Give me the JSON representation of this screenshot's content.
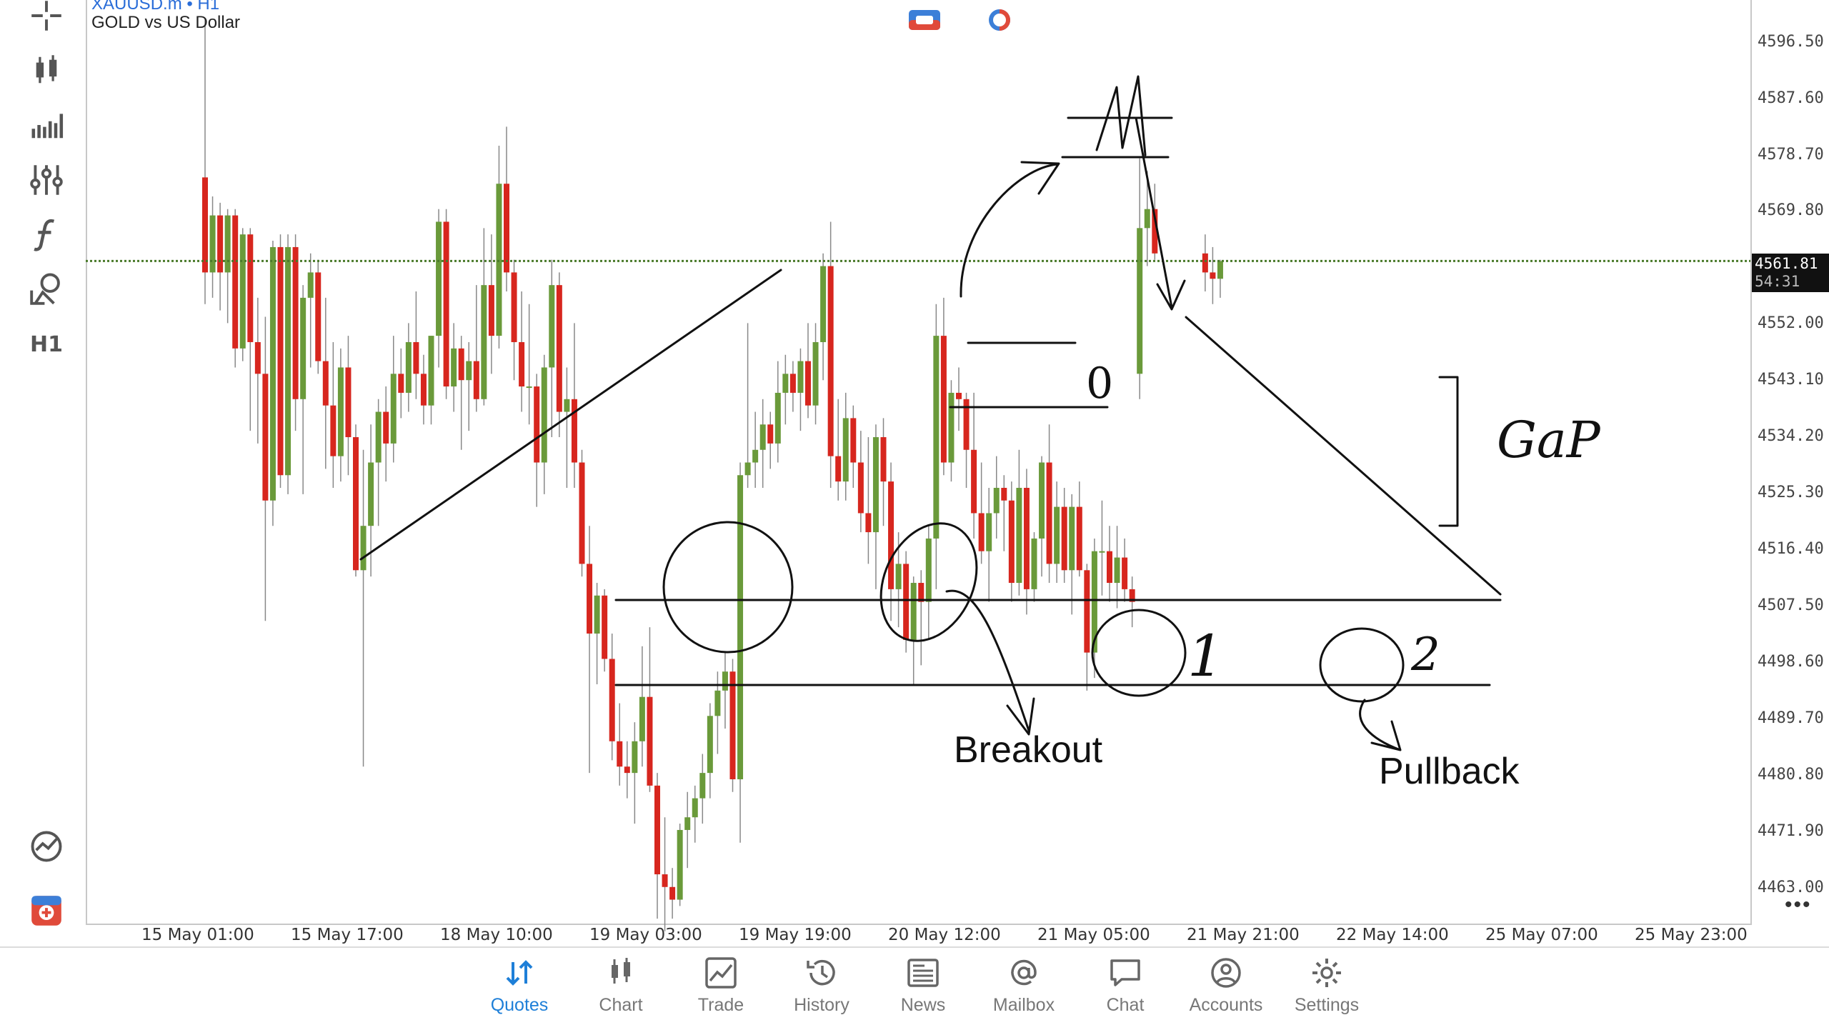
{
  "symbol": {
    "ticker": "XAUUSD.m • H1",
    "description": "GOLD vs US Dollar"
  },
  "toolbar": {
    "timeframe": "H1",
    "tools": [
      "crosshair-icon",
      "candles-icon",
      "indicators-icon",
      "settings-sliders-icon",
      "function-icon",
      "objects-icon"
    ]
  },
  "price_axis": [
    "4596.50",
    "4587.60",
    "4578.70",
    "4569.80",
    "4552.00",
    "4543.10",
    "4534.20",
    "4525.30",
    "4516.40",
    "4507.50",
    "4498.60",
    "4489.70",
    "4480.80",
    "4471.90",
    "4463.00"
  ],
  "current_price": {
    "price": "4561.81",
    "countdown": "54:31"
  },
  "time_axis": [
    "15 May 01:00",
    "15 May 17:00",
    "18 May 10:00",
    "19 May 03:00",
    "19 May 19:00",
    "20 May 12:00",
    "21 May 05:00",
    "21 May 21:00",
    "22 May 14:00",
    "25 May 07:00",
    "25 May 23:00"
  ],
  "annotations": {
    "gap": "GaP",
    "breakout": "Breakout",
    "pullback": "Pullback",
    "zero": "0",
    "one": "1",
    "two": "2"
  },
  "more": "•••",
  "nav": [
    {
      "label": "Quotes",
      "icon": "quotes-icon",
      "active": true
    },
    {
      "label": "Chart",
      "icon": "chart-icon",
      "active": false
    },
    {
      "label": "Trade",
      "icon": "trade-icon",
      "active": false
    },
    {
      "label": "History",
      "icon": "history-icon",
      "active": false
    },
    {
      "label": "News",
      "icon": "news-icon",
      "active": false
    },
    {
      "label": "Mailbox",
      "icon": "mailbox-icon",
      "active": false
    },
    {
      "label": "Chat",
      "icon": "chat-icon",
      "active": false
    },
    {
      "label": "Accounts",
      "icon": "accounts-icon",
      "active": false
    },
    {
      "label": "Settings",
      "icon": "settings-icon",
      "active": false
    }
  ],
  "colors": {
    "bull": "#6a9a3a",
    "bear": "#d7261e",
    "accent": "#1e7fd8",
    "bid_line": "#4a7a2a"
  },
  "chart_data": {
    "type": "candlestick",
    "timeframe": "H1",
    "candles": [
      {
        "o": 4575.0,
        "h": 4600.0,
        "l": 4555.0,
        "c": 4560.0
      },
      {
        "o": 4560.0,
        "h": 4572.0,
        "l": 4556.0,
        "c": 4569.0
      },
      {
        "o": 4569.0,
        "h": 4571.0,
        "l": 4554.0,
        "c": 4560.0
      },
      {
        "o": 4560.0,
        "h": 4570.0,
        "l": 4552.0,
        "c": 4569.0
      },
      {
        "o": 4569.0,
        "h": 4570.0,
        "l": 4545.0,
        "c": 4548.0
      },
      {
        "o": 4548.0,
        "h": 4567.0,
        "l": 4546.0,
        "c": 4566.0
      },
      {
        "o": 4566.0,
        "h": 4567.0,
        "l": 4535.0,
        "c": 4549.0
      },
      {
        "o": 4549.0,
        "h": 4556.0,
        "l": 4533.0,
        "c": 4544.0
      },
      {
        "o": 4544.0,
        "h": 4553.0,
        "l": 4505.0,
        "c": 4524.0
      },
      {
        "o": 4524.0,
        "h": 4565.0,
        "l": 4520.0,
        "c": 4564.0
      },
      {
        "o": 4564.0,
        "h": 4566.0,
        "l": 4526.0,
        "c": 4528.0
      },
      {
        "o": 4528.0,
        "h": 4566.0,
        "l": 4525.0,
        "c": 4564.0
      },
      {
        "o": 4564.0,
        "h": 4566.0,
        "l": 4535.0,
        "c": 4540.0
      },
      {
        "o": 4540.0,
        "h": 4558.0,
        "l": 4525.0,
        "c": 4556.0
      },
      {
        "o": 4556.0,
        "h": 4563.0,
        "l": 4545.0,
        "c": 4560.0
      },
      {
        "o": 4560.0,
        "h": 4562.0,
        "l": 4544.0,
        "c": 4546.0
      },
      {
        "o": 4546.0,
        "h": 4556.0,
        "l": 4529.0,
        "c": 4539.0
      },
      {
        "o": 4539.0,
        "h": 4549.0,
        "l": 4526.0,
        "c": 4531.0
      },
      {
        "o": 4531.0,
        "h": 4548.0,
        "l": 4527.0,
        "c": 4545.0
      },
      {
        "o": 4545.0,
        "h": 4550.0,
        "l": 4528.0,
        "c": 4534.0
      },
      {
        "o": 4534.0,
        "h": 4536.0,
        "l": 4512.0,
        "c": 4513.0
      },
      {
        "o": 4513.0,
        "h": 4532.0,
        "l": 4482.0,
        "c": 4520.0
      },
      {
        "o": 4520.0,
        "h": 4536.0,
        "l": 4512.0,
        "c": 4530.0
      },
      {
        "o": 4530.0,
        "h": 4540.0,
        "l": 4520.0,
        "c": 4538.0
      },
      {
        "o": 4538.0,
        "h": 4542.0,
        "l": 4527.0,
        "c": 4533.0
      },
      {
        "o": 4533.0,
        "h": 4550.0,
        "l": 4530.0,
        "c": 4544.0
      },
      {
        "o": 4544.0,
        "h": 4548.0,
        "l": 4537.0,
        "c": 4541.0
      },
      {
        "o": 4541.0,
        "h": 4552.0,
        "l": 4538.0,
        "c": 4549.0
      },
      {
        "o": 4549.0,
        "h": 4557.0,
        "l": 4540.0,
        "c": 4544.0
      },
      {
        "o": 4544.0,
        "h": 4547.0,
        "l": 4536.0,
        "c": 4539.0
      },
      {
        "o": 4539.0,
        "h": 4550.0,
        "l": 4536.0,
        "c": 4550.0
      },
      {
        "o": 4550.0,
        "h": 4570.0,
        "l": 4545.0,
        "c": 4568.0
      },
      {
        "o": 4568.0,
        "h": 4570.0,
        "l": 4540.0,
        "c": 4542.0
      },
      {
        "o": 4542.0,
        "h": 4552.0,
        "l": 4538.0,
        "c": 4548.0
      },
      {
        "o": 4548.0,
        "h": 4550.0,
        "l": 4532.0,
        "c": 4543.0
      },
      {
        "o": 4543.0,
        "h": 4549.0,
        "l": 4535.0,
        "c": 4546.0
      },
      {
        "o": 4546.0,
        "h": 4558.0,
        "l": 4538.0,
        "c": 4540.0
      },
      {
        "o": 4540.0,
        "h": 4567.0,
        "l": 4539.0,
        "c": 4558.0
      },
      {
        "o": 4558.0,
        "h": 4566.0,
        "l": 4544.0,
        "c": 4550.0
      },
      {
        "o": 4550.0,
        "h": 4580.0,
        "l": 4548.0,
        "c": 4574.0
      },
      {
        "o": 4574.0,
        "h": 4583.0,
        "l": 4557.0,
        "c": 4560.0
      },
      {
        "o": 4560.0,
        "h": 4562.0,
        "l": 4543.0,
        "c": 4549.0
      },
      {
        "o": 4549.0,
        "h": 4557.0,
        "l": 4538.0,
        "c": 4542.0
      },
      {
        "o": 4542.0,
        "h": 4555.0,
        "l": 4536.0,
        "c": 4542.0
      },
      {
        "o": 4542.0,
        "h": 4544.0,
        "l": 4523.0,
        "c": 4530.0
      },
      {
        "o": 4530.0,
        "h": 4547.0,
        "l": 4525.0,
        "c": 4545.0
      },
      {
        "o": 4545.0,
        "h": 4562.0,
        "l": 4534.0,
        "c": 4558.0
      },
      {
        "o": 4558.0,
        "h": 4560.0,
        "l": 4534.0,
        "c": 4538.0
      },
      {
        "o": 4538.0,
        "h": 4545.0,
        "l": 4526.0,
        "c": 4540.0
      },
      {
        "o": 4540.0,
        "h": 4552.0,
        "l": 4526.0,
        "c": 4530.0
      },
      {
        "o": 4530.0,
        "h": 4532.0,
        "l": 4512.0,
        "c": 4514.0
      },
      {
        "o": 4514.0,
        "h": 4520.0,
        "l": 4481.0,
        "c": 4503.0
      },
      {
        "o": 4503.0,
        "h": 4511.0,
        "l": 4495.0,
        "c": 4509.0
      },
      {
        "o": 4509.0,
        "h": 4510.0,
        "l": 4497.0,
        "c": 4499.0
      },
      {
        "o": 4499.0,
        "h": 4503.0,
        "l": 4483.0,
        "c": 4486.0
      },
      {
        "o": 4486.0,
        "h": 4492.0,
        "l": 4479.0,
        "c": 4482.0
      },
      {
        "o": 4482.0,
        "h": 4486.0,
        "l": 4477.0,
        "c": 4481.0
      },
      {
        "o": 4481.0,
        "h": 4489.0,
        "l": 4473.0,
        "c": 4486.0
      },
      {
        "o": 4486.0,
        "h": 4501.0,
        "l": 4482.0,
        "c": 4493.0
      },
      {
        "o": 4493.0,
        "h": 4504.0,
        "l": 4478.0,
        "c": 4479.0
      },
      {
        "o": 4479.0,
        "h": 4481.0,
        "l": 4458.0,
        "c": 4465.0
      },
      {
        "o": 4465.0,
        "h": 4474.0,
        "l": 4456.0,
        "c": 4463.0
      },
      {
        "o": 4463.0,
        "h": 4466.0,
        "l": 4458.0,
        "c": 4461.0
      },
      {
        "o": 4461.0,
        "h": 4473.0,
        "l": 4460.0,
        "c": 4472.0
      },
      {
        "o": 4472.0,
        "h": 4478.0,
        "l": 4466.0,
        "c": 4474.0
      },
      {
        "o": 4474.0,
        "h": 4479.0,
        "l": 4470.0,
        "c": 4477.0
      },
      {
        "o": 4477.0,
        "h": 4484.0,
        "l": 4473.0,
        "c": 4481.0
      },
      {
        "o": 4481.0,
        "h": 4492.0,
        "l": 4477.0,
        "c": 4490.0
      },
      {
        "o": 4490.0,
        "h": 4497.0,
        "l": 4484.0,
        "c": 4494.0
      },
      {
        "o": 4494.0,
        "h": 4500.0,
        "l": 4488.0,
        "c": 4497.0
      },
      {
        "o": 4497.0,
        "h": 4499.0,
        "l": 4478.0,
        "c": 4480.0
      },
      {
        "o": 4480.0,
        "h": 4530.0,
        "l": 4470.0,
        "c": 4528.0
      },
      {
        "o": 4528.0,
        "h": 4552.0,
        "l": 4526.0,
        "c": 4530.0
      },
      {
        "o": 4530.0,
        "h": 4538.0,
        "l": 4526.0,
        "c": 4532.0
      },
      {
        "o": 4532.0,
        "h": 4540.0,
        "l": 4526.0,
        "c": 4536.0
      },
      {
        "o": 4536.0,
        "h": 4538.0,
        "l": 4529.0,
        "c": 4533.0
      },
      {
        "o": 4533.0,
        "h": 4546.0,
        "l": 4530.0,
        "c": 4541.0
      },
      {
        "o": 4541.0,
        "h": 4547.0,
        "l": 4536.0,
        "c": 4544.0
      },
      {
        "o": 4544.0,
        "h": 4546.0,
        "l": 4538.0,
        "c": 4541.0
      },
      {
        "o": 4541.0,
        "h": 4548.0,
        "l": 4535.0,
        "c": 4546.0
      },
      {
        "o": 4546.0,
        "h": 4552.0,
        "l": 4537.0,
        "c": 4539.0
      },
      {
        "o": 4539.0,
        "h": 4552.0,
        "l": 4536.0,
        "c": 4549.0
      },
      {
        "o": 4549.0,
        "h": 4563.0,
        "l": 4543.0,
        "c": 4561.0
      },
      {
        "o": 4561.0,
        "h": 4568.0,
        "l": 4526.0,
        "c": 4531.0
      },
      {
        "o": 4531.0,
        "h": 4540.0,
        "l": 4524.0,
        "c": 4527.0
      },
      {
        "o": 4527.0,
        "h": 4541.0,
        "l": 4524.0,
        "c": 4537.0
      },
      {
        "o": 4537.0,
        "h": 4539.0,
        "l": 4526.0,
        "c": 4530.0
      },
      {
        "o": 4530.0,
        "h": 4535.0,
        "l": 4519.0,
        "c": 4522.0
      },
      {
        "o": 4522.0,
        "h": 4534.0,
        "l": 4514.0,
        "c": 4519.0
      },
      {
        "o": 4519.0,
        "h": 4536.0,
        "l": 4510.0,
        "c": 4534.0
      },
      {
        "o": 4534.0,
        "h": 4537.0,
        "l": 4520.0,
        "c": 4527.0
      },
      {
        "o": 4527.0,
        "h": 4530.0,
        "l": 4505.0,
        "c": 4510.0
      },
      {
        "o": 4510.0,
        "h": 4519.0,
        "l": 4504.0,
        "c": 4514.0
      },
      {
        "o": 4514.0,
        "h": 4516.0,
        "l": 4500.0,
        "c": 4502.0
      },
      {
        "o": 4502.0,
        "h": 4512.0,
        "l": 4495.0,
        "c": 4511.0
      },
      {
        "o": 4511.0,
        "h": 4513.0,
        "l": 4498.0,
        "c": 4508.0
      },
      {
        "o": 4508.0,
        "h": 4520.0,
        "l": 4502.0,
        "c": 4518.0
      },
      {
        "o": 4518.0,
        "h": 4555.0,
        "l": 4510.0,
        "c": 4550.0
      },
      {
        "o": 4550.0,
        "h": 4556.0,
        "l": 4528.0,
        "c": 4530.0
      },
      {
        "o": 4530.0,
        "h": 4543.0,
        "l": 4527.0,
        "c": 4541.0
      },
      {
        "o": 4541.0,
        "h": 4545.0,
        "l": 4535.0,
        "c": 4540.0
      },
      {
        "o": 4540.0,
        "h": 4541.0,
        "l": 4526.0,
        "c": 4532.0
      },
      {
        "o": 4532.0,
        "h": 4541.0,
        "l": 4518.0,
        "c": 4522.0
      },
      {
        "o": 4522.0,
        "h": 4530.0,
        "l": 4514.0,
        "c": 4516.0
      },
      {
        "o": 4516.0,
        "h": 4526.0,
        "l": 4508.0,
        "c": 4522.0
      },
      {
        "o": 4522.0,
        "h": 4531.0,
        "l": 4518.0,
        "c": 4526.0
      },
      {
        "o": 4526.0,
        "h": 4528.0,
        "l": 4516.0,
        "c": 4524.0
      },
      {
        "o": 4524.0,
        "h": 4527.0,
        "l": 4508.0,
        "c": 4511.0
      },
      {
        "o": 4511.0,
        "h": 4532.0,
        "l": 4509.0,
        "c": 4526.0
      },
      {
        "o": 4526.0,
        "h": 4529.0,
        "l": 4506.0,
        "c": 4510.0
      },
      {
        "o": 4510.0,
        "h": 4519.0,
        "l": 4508.0,
        "c": 4518.0
      },
      {
        "o": 4518.0,
        "h": 4531.0,
        "l": 4512.0,
        "c": 4530.0
      },
      {
        "o": 4530.0,
        "h": 4536.0,
        "l": 4511.0,
        "c": 4514.0
      },
      {
        "o": 4514.0,
        "h": 4527.0,
        "l": 4511.0,
        "c": 4523.0
      },
      {
        "o": 4523.0,
        "h": 4526.0,
        "l": 4511.0,
        "c": 4513.0
      },
      {
        "o": 4513.0,
        "h": 4525.0,
        "l": 4506.0,
        "c": 4523.0
      },
      {
        "o": 4523.0,
        "h": 4527.0,
        "l": 4512.0,
        "c": 4513.0
      },
      {
        "o": 4513.0,
        "h": 4514.0,
        "l": 4494.0,
        "c": 4500.0
      },
      {
        "o": 4500.0,
        "h": 4518.0,
        "l": 4496.0,
        "c": 4516.0
      },
      {
        "o": 4516.0,
        "h": 4524.0,
        "l": 4509.0,
        "c": 4516.0
      },
      {
        "o": 4516.0,
        "h": 4520.0,
        "l": 4508.0,
        "c": 4511.0
      },
      {
        "o": 4511.0,
        "h": 4520.0,
        "l": 4507.0,
        "c": 4515.0
      },
      {
        "o": 4515.0,
        "h": 4518.0,
        "l": 4508.0,
        "c": 4510.0
      },
      {
        "o": 4510.0,
        "h": 4512.0,
        "l": 4504.0,
        "c": 4508.0
      },
      {
        "o": 4544.0,
        "h": 4578.0,
        "l": 4540.0,
        "c": 4567.0
      },
      {
        "o": 4567.0,
        "h": 4576.0,
        "l": 4561.0,
        "c": 4570.0
      },
      {
        "o": 4570.0,
        "h": 4574.0,
        "l": 4562.0,
        "c": 4563.0
      },
      {
        "o": 4563.0,
        "h": 4566.0,
        "l": 4557.0,
        "c": 4560.0
      },
      {
        "o": 4560.0,
        "h": 4564.0,
        "l": 4555.0,
        "c": 4559.0
      },
      {
        "o": 4559.0,
        "h": 4562.0,
        "l": 4556.0,
        "c": 4561.8
      }
    ],
    "gap_after_index": 126,
    "current_price": 4561.81,
    "ylim": [
      4457.0,
      4603.0
    ],
    "price_ticks": [
      4596.5,
      4587.6,
      4578.7,
      4569.8,
      4552.0,
      4543.1,
      4534.2,
      4525.3,
      4516.4,
      4507.5,
      4498.6,
      4489.7,
      4480.8,
      4471.9,
      4463.0
    ]
  }
}
